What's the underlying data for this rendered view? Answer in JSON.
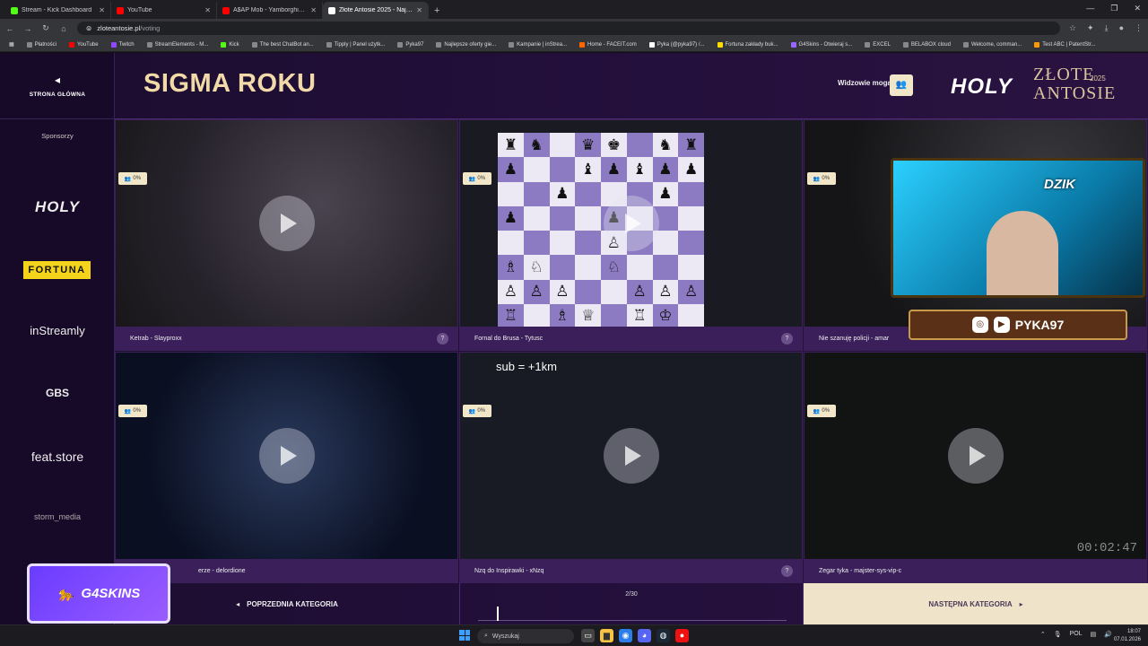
{
  "browser": {
    "tabs": [
      {
        "title": "Stream - Kick Dashboard",
        "color": "#53fc18",
        "active": false
      },
      {
        "title": "YouTube",
        "color": "#ff0000",
        "active": false
      },
      {
        "title": "A$AP Mob - Yamborghini High",
        "color": "#ff0000",
        "active": false
      },
      {
        "title": "Złote Antosie 2025 - Największe",
        "color": "#ffffff",
        "active": true
      }
    ],
    "url_host": "zloteantosie.pl",
    "url_path": "/voting",
    "bookmarks": [
      "Płatności",
      "YouTube",
      "Twitch",
      "StreamElements - M...",
      "Kick",
      "The best ChatBot an...",
      "Tipply | Panel użytk...",
      "Pyka97",
      "Najlepsze oferty gie...",
      "Kampanie | inStrea...",
      "Home - FACEIT.com",
      "Pyka (@pyka97) /...",
      "Fortuna zakłady buk...",
      "G4Skins - Otwieraj s...",
      "EXCEL",
      "BELABOX cloud",
      "Welcome, comman...",
      "Test ABC | PatentStr..."
    ]
  },
  "sidebar": {
    "home_label": "STRONA GŁÓWNA",
    "sponsors_title": "Sponsorzy",
    "sponsors": [
      "HOLY",
      "FORTUNA",
      "inStreamly",
      "GBS",
      "feat.store",
      "storm_media"
    ]
  },
  "header": {
    "title": "SIGMA ROKU",
    "viewers_label": "Widzowie mogą",
    "brand_holy": "HOLY",
    "brand_zlote": "ZŁOTE",
    "brand_antosie": "ANTOSIE",
    "brand_year": "2025"
  },
  "nominees": [
    {
      "caption": "Ketrab - Slayproxx",
      "pct": "0%"
    },
    {
      "caption": "Fornal do Brusa - Tytusc",
      "pct": "0%"
    },
    {
      "caption": "Nie szanuję policji - amar",
      "pct": "0%"
    },
    {
      "caption": "erze - delordione",
      "pct": "0%"
    },
    {
      "caption": "Nzq do Inspirawki - xNzq",
      "pct": "0%"
    },
    {
      "caption": "Zegar tyka - majster-sys-vip-c",
      "pct": "0%"
    }
  ],
  "overlay": {
    "sub_text": "sub = +1km",
    "timer": "00:02:47",
    "cam_brand": "DZIK",
    "social_handle": "PYKA97",
    "g4skins": "G4SKINS"
  },
  "nav": {
    "prev_label": "POPRZEDNIA KATEGORIA",
    "next_label": "NASTĘPNA KATEGORIA",
    "count": "2/30",
    "progress": 0.0667
  },
  "taskbar": {
    "search_placeholder": "Wyszukaj",
    "lang": "POL",
    "time": "18:07",
    "date": "07.01.2026"
  },
  "colors": {
    "accent_gold": "#f2d9a8",
    "page_bg": "#230f3b",
    "next_bg": "#efe4c9"
  }
}
